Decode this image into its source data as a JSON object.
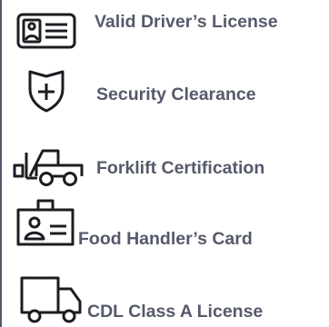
{
  "theme": {
    "ink": "#555a6b",
    "outline": "#1c1c22"
  },
  "certifications": [
    {
      "label": "Valid Driver’s License",
      "icon": "id-card-icon"
    },
    {
      "label": "Security Clearance",
      "icon": "shield-plus-icon"
    },
    {
      "label": "Forklift Certification",
      "icon": "forklift-icon"
    },
    {
      "label": "Food Handler’s Card",
      "icon": "badge-icon"
    },
    {
      "label": "CDL Class A License",
      "icon": "truck-icon"
    }
  ]
}
